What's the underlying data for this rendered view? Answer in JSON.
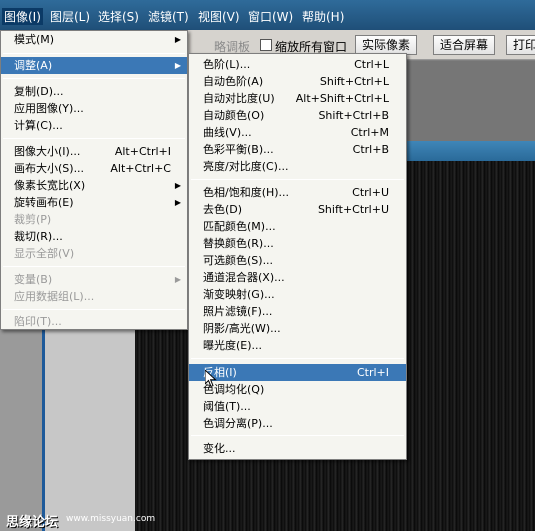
{
  "menubar": {
    "items": [
      "图像(I)",
      "图层(L)",
      "选择(S)",
      "滤镜(T)",
      "视图(V)",
      "窗口(W)",
      "帮助(H)"
    ]
  },
  "options_bar": {
    "partial_label": "略调板",
    "check_label": "缩放所有窗口",
    "actual_pixels": "实际像素",
    "fit_screen": "适合屏幕",
    "print_partial": "打印"
  },
  "image_menu": {
    "items": [
      {
        "label": "模式(M)",
        "shortcut": "",
        "submenu": true,
        "disabled": false
      },
      {
        "label": "调整(A)",
        "shortcut": "",
        "submenu": true,
        "disabled": false,
        "highlighted": true
      },
      {
        "label": "复制(D)...",
        "shortcut": "",
        "submenu": false,
        "disabled": false
      },
      {
        "label": "应用图像(Y)...",
        "shortcut": "",
        "submenu": false,
        "disabled": false
      },
      {
        "label": "计算(C)...",
        "shortcut": "",
        "submenu": false,
        "disabled": false
      },
      {
        "label": "图像大小(I)...",
        "shortcut": "Alt+Ctrl+I",
        "submenu": false,
        "disabled": false
      },
      {
        "label": "画布大小(S)...",
        "shortcut": "Alt+Ctrl+C",
        "submenu": false,
        "disabled": false
      },
      {
        "label": "像素长宽比(X)",
        "shortcut": "",
        "submenu": true,
        "disabled": false
      },
      {
        "label": "旋转画布(E)",
        "shortcut": "",
        "submenu": true,
        "disabled": false
      },
      {
        "label": "裁剪(P)",
        "shortcut": "",
        "submenu": false,
        "disabled": true
      },
      {
        "label": "裁切(R)...",
        "shortcut": "",
        "submenu": false,
        "disabled": false
      },
      {
        "label": "显示全部(V)",
        "shortcut": "",
        "submenu": false,
        "disabled": true
      },
      {
        "label": "变量(B)",
        "shortcut": "",
        "submenu": true,
        "disabled": true
      },
      {
        "label": "应用数据组(L)...",
        "shortcut": "",
        "submenu": false,
        "disabled": true
      },
      {
        "label": "陷印(T)...",
        "shortcut": "",
        "submenu": false,
        "disabled": true
      }
    ]
  },
  "adjust_menu": {
    "items": [
      {
        "label": "色阶(L)...",
        "shortcut": "Ctrl+L"
      },
      {
        "label": "自动色阶(A)",
        "shortcut": "Shift+Ctrl+L"
      },
      {
        "label": "自动对比度(U)",
        "shortcut": "Alt+Shift+Ctrl+L"
      },
      {
        "label": "自动颜色(O)",
        "shortcut": "Shift+Ctrl+B"
      },
      {
        "label": "曲线(V)...",
        "shortcut": "Ctrl+M"
      },
      {
        "label": "色彩平衡(B)...",
        "shortcut": "Ctrl+B"
      },
      {
        "label": "亮度/对比度(C)...",
        "shortcut": ""
      },
      {
        "label": "色相/饱和度(H)...",
        "shortcut": "Ctrl+U"
      },
      {
        "label": "去色(D)",
        "shortcut": "Shift+Ctrl+U"
      },
      {
        "label": "匹配颜色(M)...",
        "shortcut": ""
      },
      {
        "label": "替换颜色(R)...",
        "shortcut": ""
      },
      {
        "label": "可选颜色(S)...",
        "shortcut": ""
      },
      {
        "label": "通道混合器(X)...",
        "shortcut": ""
      },
      {
        "label": "渐变映射(G)...",
        "shortcut": ""
      },
      {
        "label": "照片滤镜(F)...",
        "shortcut": ""
      },
      {
        "label": "阴影/高光(W)...",
        "shortcut": ""
      },
      {
        "label": "曝光度(E)...",
        "shortcut": ""
      },
      {
        "label": "反相(I)",
        "shortcut": "Ctrl+I",
        "highlighted": true
      },
      {
        "label": "色调均化(Q)",
        "shortcut": ""
      },
      {
        "label": "阈值(T)...",
        "shortcut": ""
      },
      {
        "label": "色调分离(P)...",
        "shortcut": ""
      },
      {
        "label": "变化...",
        "shortcut": ""
      }
    ]
  },
  "watermark": {
    "site_cn": "思缘论坛",
    "url": "www.missyuan.com"
  },
  "colors": {
    "menubar": "#2f6b9a",
    "highlight": "#3b78b6",
    "menu_bg": "#f5f5f0"
  }
}
